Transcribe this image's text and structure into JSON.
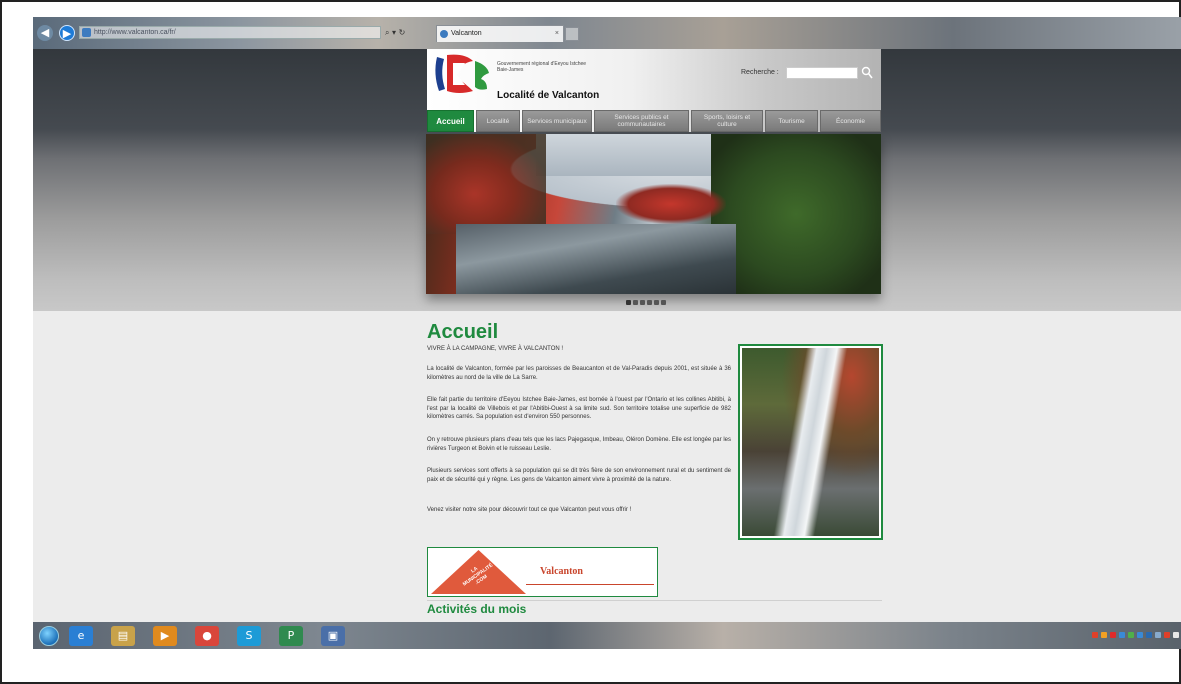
{
  "browser": {
    "address": "http://www.valcanton.ca/fr/",
    "addr_tools": "⌕ ▾ ↻",
    "tab_title": "Valcanton",
    "tab_close": "×"
  },
  "header": {
    "gov_text": "Gouvernement régional d'Eeyou Istchee Baie-James",
    "site_title": "Localité de Valcanton",
    "search_label": "Recherche :"
  },
  "menu": [
    {
      "label": "Accueil"
    },
    {
      "label": "Localité"
    },
    {
      "label": "Services municipaux"
    },
    {
      "label": "Services publics et communautaires"
    },
    {
      "label": "Sports, loisirs et culture"
    },
    {
      "label": "Tourisme"
    },
    {
      "label": "Économie"
    }
  ],
  "slider": {
    "slide_count": 6,
    "active_slide": 1
  },
  "content": {
    "title": "Accueil",
    "subtitle": "VIVRE À LA CAMPAGNE, VIVRE À VALCANTON !",
    "paragraphs": [
      "La localité de Valcanton, formée par les paroisses de Beaucanton et de Val-Paradis depuis 2001, est située à 36 kilomètres au nord de la ville de La Sarre.",
      "Elle fait partie du territoire d'Eeyou Istchee Baie-James, est bornée à l'ouest par l'Ontario et les collines Abitibi, à l'est par la localité de Villebois et par l'Abitibi-Ouest à sa limite sud. Son territoire totalise une superficie de 982 kilomètres carrés. Sa population est d'environ 550 personnes.",
      "On y retrouve plusieurs plans d'eau tels que les lacs Pajegasque, Imbeau, Oléron Domène. Elle est longée par les rivières Turgeon et Boivin et le ruisseau Leslie.",
      "Plusieurs services sont offerts à sa population qui se dit très fière de son environnement rural et du sentiment de paix et de sécurité qui y règne. Les gens de Valcanton aiment vivre à proximité de la nature.",
      "Venez visiter notre site pour découvrir tout ce que Valcanton peut vous offrir !"
    ],
    "banner_logo_text": "LA MUNICIPALITÉ .COM",
    "banner_title": "Valcanton",
    "activities_heading": "Activités du mois"
  },
  "taskbar": {
    "apps": [
      {
        "name": "internet-explorer",
        "glyph": "e",
        "color": "#2a7fd4"
      },
      {
        "name": "file-explorer",
        "glyph": "▤",
        "color": "#c8a24a"
      },
      {
        "name": "media-player",
        "glyph": "▶",
        "color": "#e08a1e"
      },
      {
        "name": "chrome",
        "glyph": "●",
        "color": "#d9463b"
      },
      {
        "name": "skype",
        "glyph": "S",
        "color": "#1d9bd7"
      },
      {
        "name": "publisher",
        "glyph": "P",
        "color": "#2f8a4f"
      },
      {
        "name": "image-viewer",
        "glyph": "▣",
        "color": "#4a6fa8"
      }
    ],
    "tray_colors": [
      "#e0402a",
      "#f2a024",
      "#e02a2a",
      "#3a8ad6",
      "#4fb04a",
      "#3a8ad6",
      "#2a6ab0",
      "#8ac",
      "#e0402a",
      "#e8e8e8"
    ]
  },
  "colors": {
    "accent": "#1f8a3f",
    "banner_red": "#c9452c"
  }
}
